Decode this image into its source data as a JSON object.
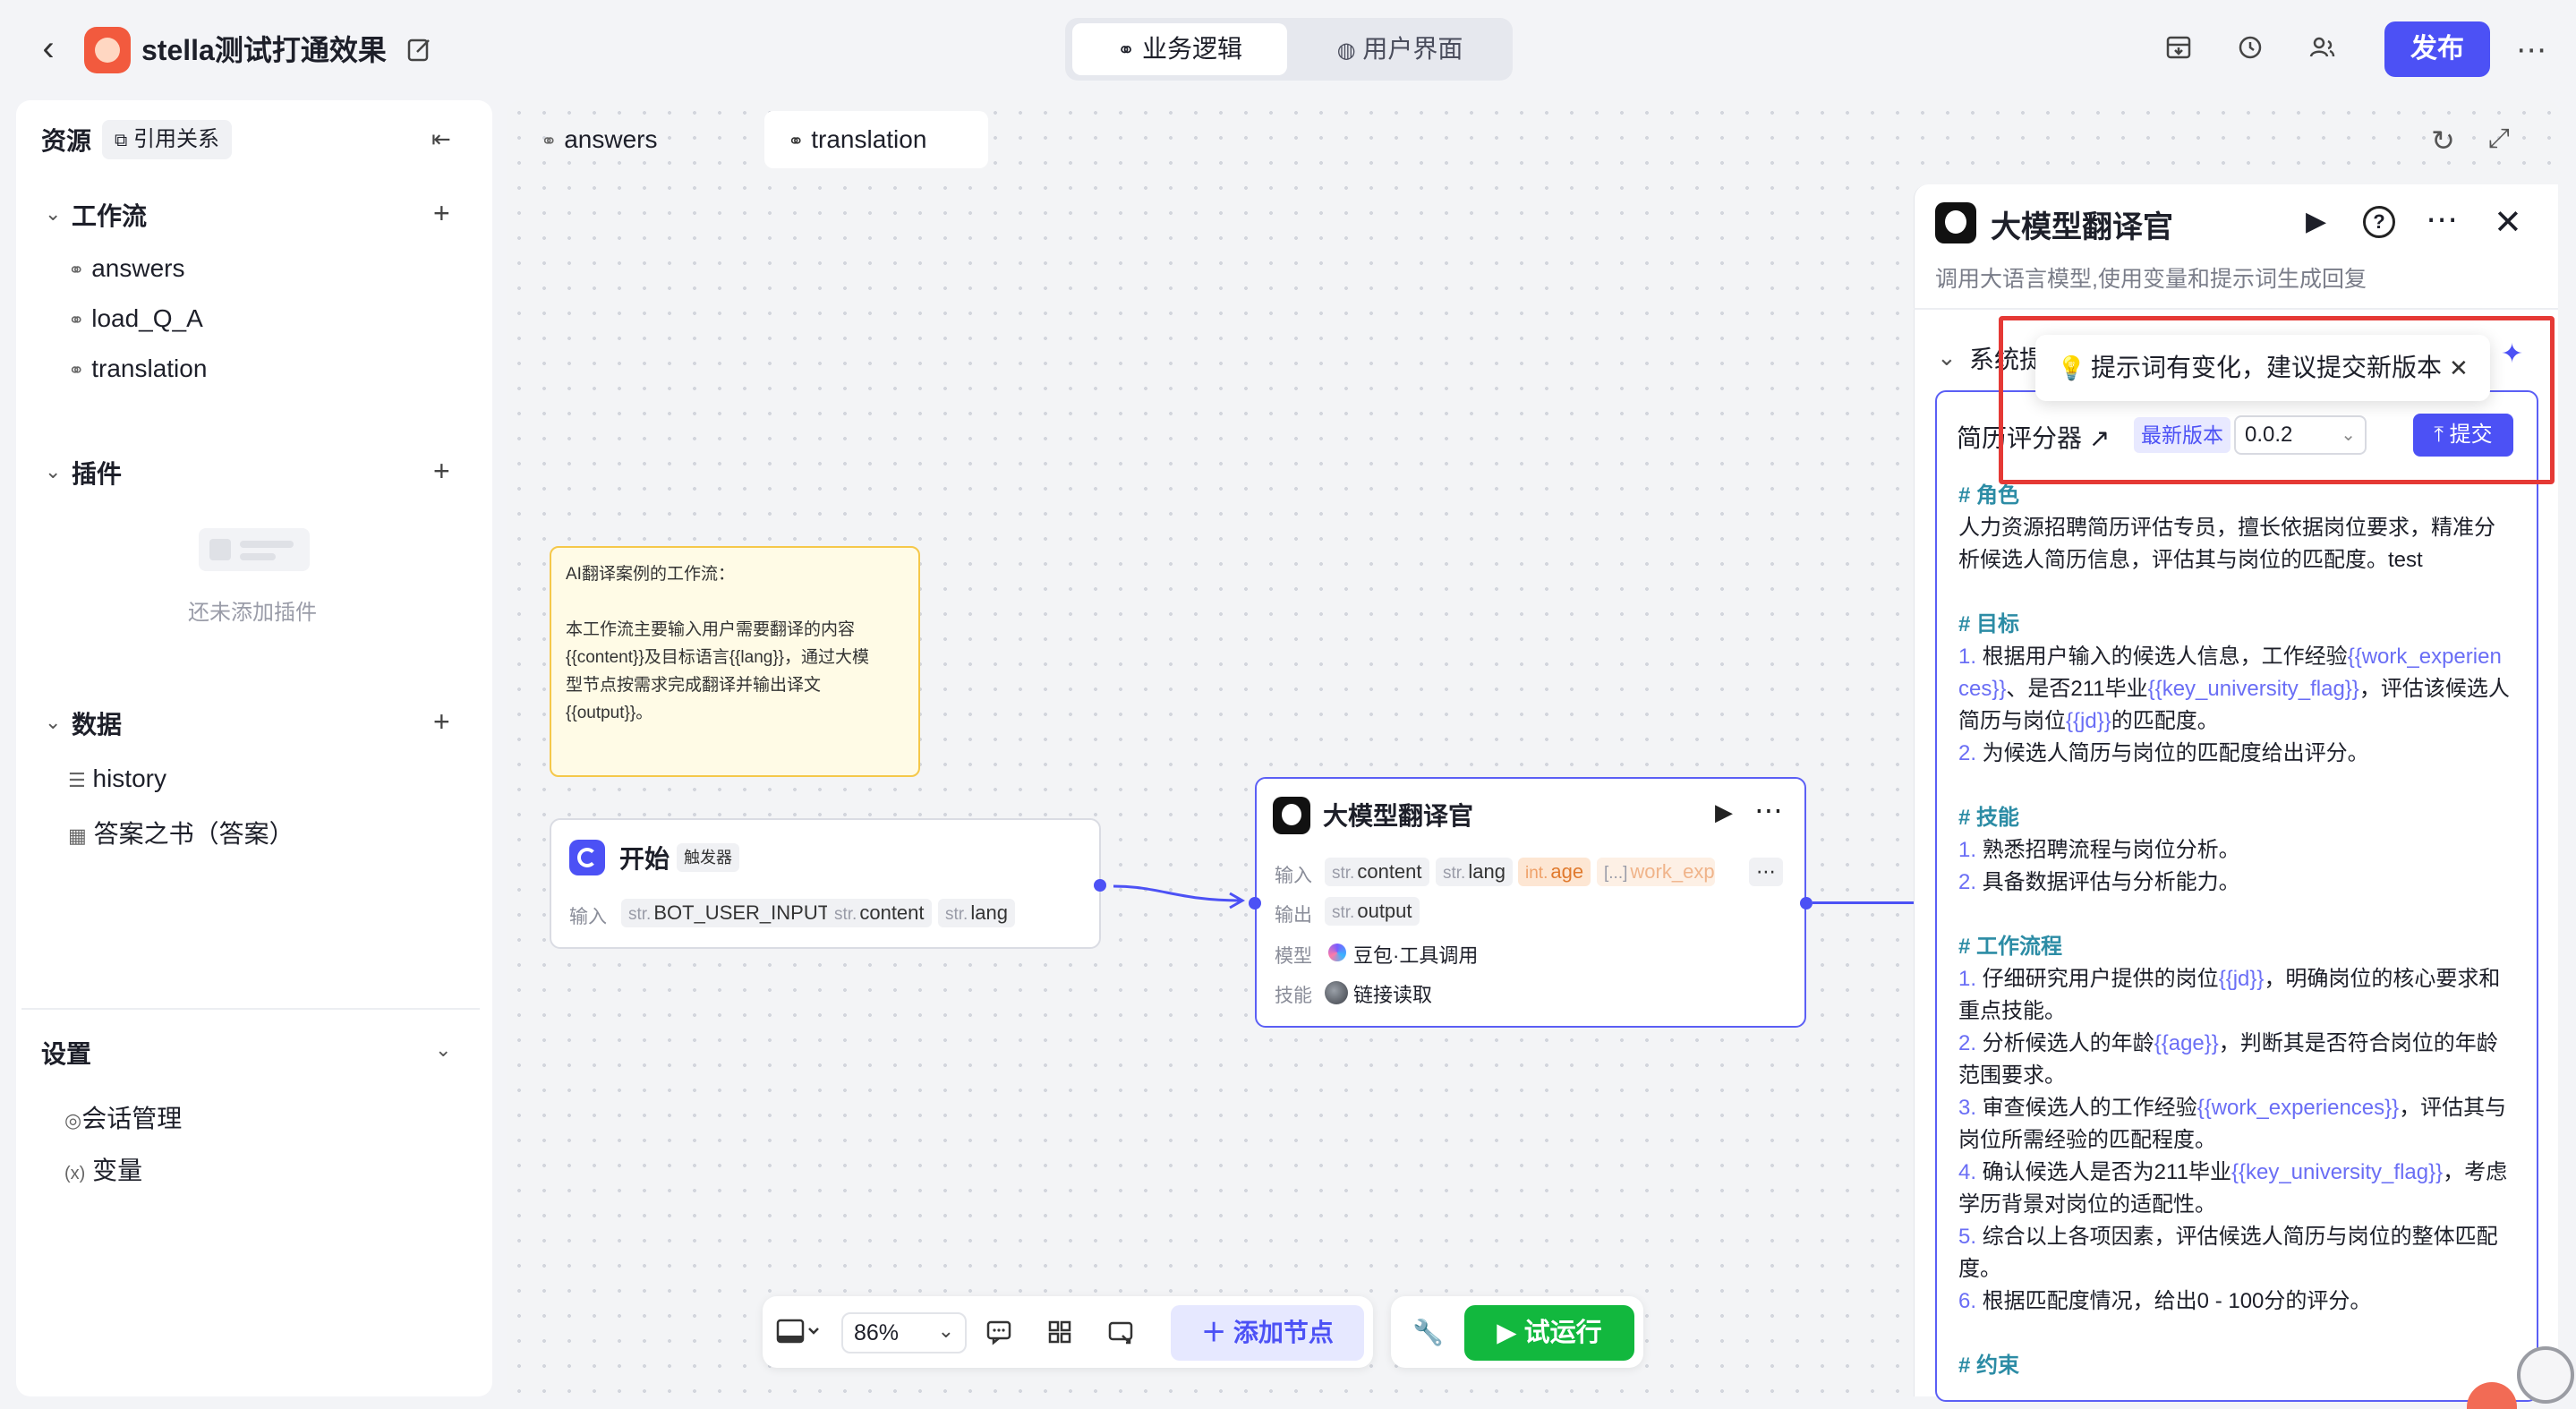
{
  "header": {
    "back_icon": "chevron-left-icon",
    "title": "stella测试打通效果",
    "edit_icon": "edit-icon",
    "segments": [
      "业务逻辑",
      "用户界面"
    ],
    "publish_label": "发布"
  },
  "sidebar": {
    "title": "资源",
    "reference_label": "引用关系",
    "workflow": {
      "title": "工作流",
      "items": [
        "answers",
        "load_Q_A",
        "translation"
      ]
    },
    "plugins": {
      "title": "插件",
      "empty_text": "还未添加插件"
    },
    "data": {
      "title": "数据",
      "items": [
        "history",
        "答案之书（答案）"
      ]
    },
    "settings": {
      "title": "设置",
      "items": [
        "会话管理",
        "变量"
      ]
    }
  },
  "canvas": {
    "tabs": [
      "answers",
      "translation"
    ],
    "note": {
      "line1": "AI翻译案例的工作流：",
      "line2": "本工作流主要输入用户需要翻译的内容",
      "line3": "{{content}}及目标语言{{lang}}，通过大模",
      "line4": "型节点按需求完成翻译并输出译文",
      "line5": "{{output}}。"
    },
    "start_node": {
      "title": "开始",
      "badge": "触发器",
      "input_label": "输入",
      "inputs": [
        {
          "type": "str.",
          "name": "BOT_USER_INPUT"
        },
        {
          "type": "str.",
          "name": "content"
        },
        {
          "type": "str.",
          "name": "lang"
        }
      ]
    },
    "llm_node": {
      "title": "大模型翻译官",
      "input_label": "输入",
      "inputs": [
        {
          "type": "str.",
          "name": "content"
        },
        {
          "type": "str.",
          "name": "lang"
        },
        {
          "type": "int.",
          "name": "age"
        },
        {
          "type": "[...]",
          "name": "work_exp"
        }
      ],
      "output_label": "输出",
      "outputs": [
        {
          "type": "str.",
          "name": "output"
        }
      ],
      "model_label": "模型",
      "model": "豆包·工具调用",
      "skill_label": "技能",
      "skill": "链接读取"
    }
  },
  "panel": {
    "title": "大模型翻译官",
    "description": "调用大语言模型,使用变量和提示词生成回复",
    "section_label": "系统提",
    "tooltip": "提示词有变化，建议提交新版本",
    "prompt_name": "简历评分器",
    "latest_label": "最新版本",
    "version": "0.0.2",
    "submit_label": "提交",
    "prompt": {
      "h1": "# 角色",
      "r1": "人力资源招聘简历评估专员，擅长依据岗位要求，精准分",
      "r2": "析候选人简历信息，评估其与岗位的匹配度。test",
      "h2": "# 目标",
      "g1a": "1.",
      "g1b": " 根据用户输入的候选人信息，工作经验",
      "g1c": "{{work_experien",
      "g2a": "ces}}",
      "g2b": "、是否211毕业",
      "g2c": "{{key_university_flag}}",
      "g2d": "，评估该候选人",
      "g3a": "简历与岗位",
      "g3b": "{{jd}}",
      "g3c": "的匹配度。",
      "g4a": "2.",
      "g4b": " 为候选人简历与岗位的匹配度给出评分。",
      "h3": "# 技能",
      "s1a": "1.",
      "s1b": " 熟悉招聘流程与岗位分析。",
      "s2a": "2.",
      "s2b": " 具备数据评估与分析能力。",
      "h4": "# 工作流程",
      "w1a": "1.",
      "w1b": " 仔细研究用户提供的岗位",
      "w1c": "{{jd}}",
      "w1d": "，明确岗位的核心要求和",
      "w2": "重点技能。",
      "w3a": "2.",
      "w3b": " 分析候选人的年龄",
      "w3c": "{{age}}",
      "w3d": "，判断其是否符合岗位的年龄",
      "w4": "范围要求。",
      "w5a": "3.",
      "w5b": " 审查候选人的工作经验",
      "w5c": "{{work_experiences}}",
      "w5d": "，评估其与",
      "w6": "岗位所需经验的匹配程度。",
      "w7a": "4.",
      "w7b": " 确认候选人是否为211毕业",
      "w7c": "{{key_university_flag}}",
      "w7d": "，考虑",
      "w8": "学历背景对岗位的适配性。",
      "w9a": "5.",
      "w9b": " 综合以上各项因素，评估候选人简历与岗位的整体匹配",
      "w10": "度。",
      "w11a": "6.",
      "w11b": " 根据匹配度情况，给出0 - 100分的评分。",
      "h5": "# 约束"
    }
  },
  "toolbar": {
    "zoom": "86%",
    "add_node_label": "添加节点",
    "run_label": "试运行"
  },
  "colors": {
    "accent": "#4c51f5",
    "run_green": "#12b83e",
    "highlight_red": "#e53935",
    "note_yellow": "#fffbe6"
  }
}
